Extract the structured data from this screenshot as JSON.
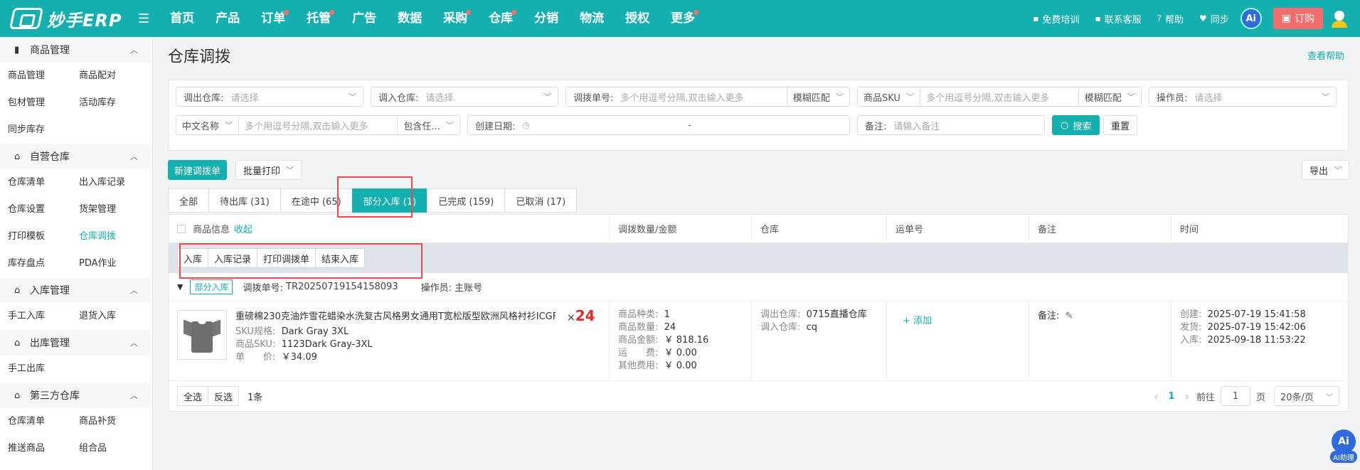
{
  "app": {
    "logo_text": "妙手ERP"
  },
  "nav": {
    "items": [
      {
        "label": "首页",
        "dot": false
      },
      {
        "label": "产品",
        "dot": false
      },
      {
        "label": "订单",
        "dot": true
      },
      {
        "label": "托管",
        "dot": true
      },
      {
        "label": "广告",
        "dot": false
      },
      {
        "label": "数据",
        "dot": false
      },
      {
        "label": "采购",
        "dot": true
      },
      {
        "label": "仓库",
        "dot": true
      },
      {
        "label": "分销",
        "dot": false
      },
      {
        "label": "物流",
        "dot": false
      },
      {
        "label": "授权",
        "dot": false
      },
      {
        "label": "更多",
        "dot": true
      }
    ],
    "right": {
      "training": "免费培训",
      "contact": "联系客服",
      "help": "帮助",
      "sync": "同步",
      "ai": "Ai",
      "order": "订购"
    }
  },
  "sidebar": {
    "sections": [
      {
        "title": "商品管理",
        "items": [
          "商品管理",
          "商品配对",
          "包材管理",
          "活动库存",
          "同步库存"
        ]
      },
      {
        "title": "自营仓库",
        "items": [
          "仓库清单",
          "出入库记录",
          "仓库设置",
          "货架管理",
          "打印模板",
          "仓库调拨",
          "库存盘点",
          "PDA作业"
        ]
      },
      {
        "title": "入库管理",
        "items": [
          "手工入库",
          "退货入库"
        ]
      },
      {
        "title": "出库管理",
        "items": [
          "手工出库"
        ]
      },
      {
        "title": "第三方仓库",
        "items": [
          "仓库清单",
          "商品补货",
          "推送商品",
          "组合品"
        ]
      }
    ],
    "active_item": "仓库调拨"
  },
  "page": {
    "title": "仓库调拨",
    "help": "查看帮助"
  },
  "filters": {
    "out_wh": {
      "label": "调出仓库:",
      "placeholder": "请选择"
    },
    "in_wh": {
      "label": "调入仓库:",
      "placeholder": "请选择"
    },
    "transfer_no": {
      "label": "调拨单号:",
      "placeholder": "多个用逗号分隔,双击输入更多",
      "match": "模糊匹配"
    },
    "sku": {
      "label": "商品SKU",
      "placeholder": "多个用逗号分隔,双击输入更多",
      "match": "模糊匹配"
    },
    "operator": {
      "label": "操作员:",
      "placeholder": "请选择"
    },
    "cn_name": {
      "label": "中文名称",
      "placeholder": "多个用逗号分隔,双击输入更多",
      "match": "包含任..."
    },
    "created": {
      "label": "创建日期:",
      "separator": "-"
    },
    "remark": {
      "label": "备注:",
      "placeholder": "请输入备注"
    },
    "search": "搜索",
    "reset": "重置"
  },
  "toolbar": {
    "new": "新建调拨单",
    "batch_print": "批量打印",
    "export": "导出"
  },
  "tabs": [
    {
      "label": "全部",
      "active": false
    },
    {
      "label": "待出库 (31)",
      "active": false
    },
    {
      "label": "在途中 (65)",
      "active": false
    },
    {
      "label": "部分入库 (1)",
      "active": true
    },
    {
      "label": "已完成 (159)",
      "active": false
    },
    {
      "label": "已取消 (17)",
      "active": false
    }
  ],
  "table": {
    "headers": {
      "product": "商品信息",
      "collapse": "收起",
      "qty_amount": "调拨数量/金额",
      "warehouse": "仓库",
      "waybill": "运单号",
      "remark": "备注",
      "time": "时间"
    },
    "actions": [
      "入库",
      "入库记录",
      "打印调拨单",
      "结束入库"
    ],
    "order": {
      "status": "部分入库",
      "no_label": "调拨单号:",
      "no": "TR20250719154158093",
      "op_label": "操作员:",
      "op": "主账号"
    },
    "item": {
      "name": "重磅棉230克油炸雪花蜡染水洗复古风格男女通用T宽松版型欧洲风格衬衫ICGF",
      "qty_prefix": "×",
      "qty": "24",
      "spec_label": "SKU规格:",
      "spec": "Dark Gray 3XL",
      "sku_label": "商品SKU:",
      "sku": "1123Dark Gray-3XL",
      "price_label": "单　　价:",
      "price": "￥34.09",
      "stats": [
        {
          "k": "商品种类:",
          "v": "1"
        },
        {
          "k": "商品数量:",
          "v": "24"
        },
        {
          "k": "商品金额:",
          "v": "￥ 818.16"
        },
        {
          "k": "运　　费:",
          "v": "￥ 0.00"
        },
        {
          "k": "其他费用:",
          "v": "￥ 0.00"
        }
      ],
      "wh_out_label": "调出仓库:",
      "wh_out": "0715直播仓库",
      "wh_in_label": "调入仓库:",
      "wh_in": "cq",
      "add": "+ 添加",
      "remark_label": "备注:",
      "times": [
        {
          "k": "创建:",
          "v": "2025-07-19 15:41:58"
        },
        {
          "k": "发货:",
          "v": "2025-07-19 15:42:06"
        },
        {
          "k": "入库:",
          "v": "2025-09-18 11:53:22"
        }
      ]
    },
    "footer": {
      "select_all": "全选",
      "invert": "反选",
      "count": "1条",
      "prev": "‹",
      "page": "1",
      "next": "›",
      "goto": "前往",
      "goto_value": "1",
      "page_unit": "页",
      "page_size": "20条/页"
    }
  },
  "ai_helper": {
    "icon": "Ai",
    "label": "AI助理"
  }
}
